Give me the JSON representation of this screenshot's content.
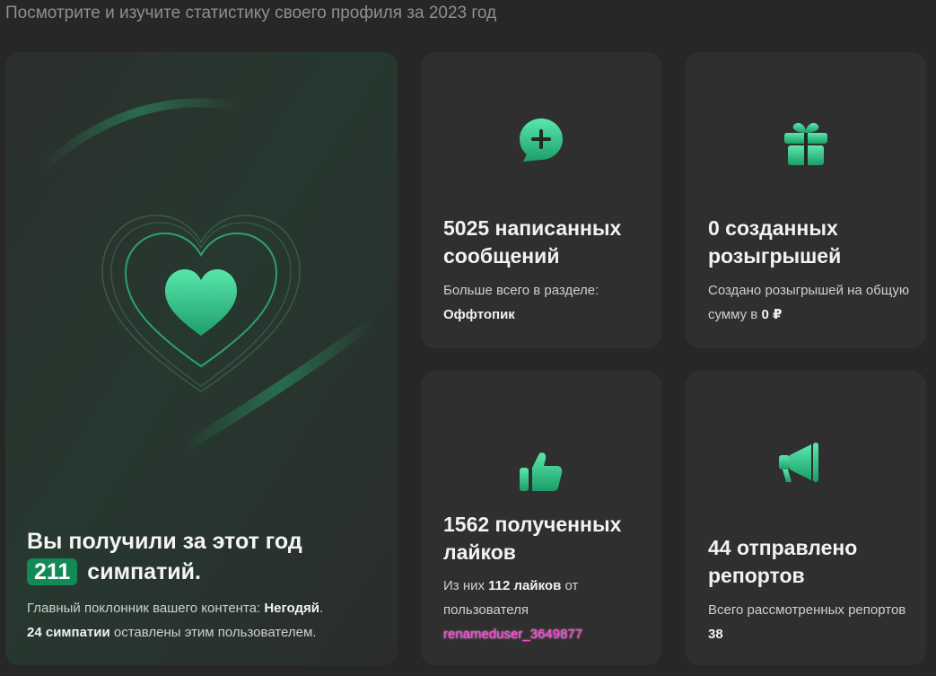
{
  "page": {
    "subtitle": "Посмотрите и изучите статистику своего профиля за 2023 год"
  },
  "likes_received": {
    "title_line1": "Вы получили за этот год",
    "count": "211",
    "title_suffix": "симпатий.",
    "desc_prefix": "Главный поклонник вашего контента: ",
    "top_fan": "Негодяй",
    "desc_mid": ".",
    "fan_count": "24 симпатии",
    "desc_suffix": " оставлены этим пользователем.",
    "icon": "heart-icon"
  },
  "messages": {
    "title": "5025 написанных сообщений",
    "desc": "Больше всего в разделе:",
    "section": "Оффтопик",
    "icon": "chat-plus-icon"
  },
  "giveaways": {
    "title": "0 созданных розыгрышей",
    "desc": "Создано розыгрышей на общую сумму в ",
    "sum": "0 ₽",
    "icon": "gift-icon"
  },
  "likes": {
    "title": "1562 полученных лайков",
    "desc_prefix": "Из них ",
    "count": "112 лайков",
    "desc_mid": " от пользователя",
    "user": "renameduser_3649877",
    "icon": "thumbs-up-icon"
  },
  "reports": {
    "title": "44 отправлено репортов",
    "desc": "Всего рассмотренных репортов ",
    "count": "38",
    "icon": "megaphone-icon"
  },
  "colors": {
    "accent": "#2fd495",
    "badge": "#138a55"
  }
}
